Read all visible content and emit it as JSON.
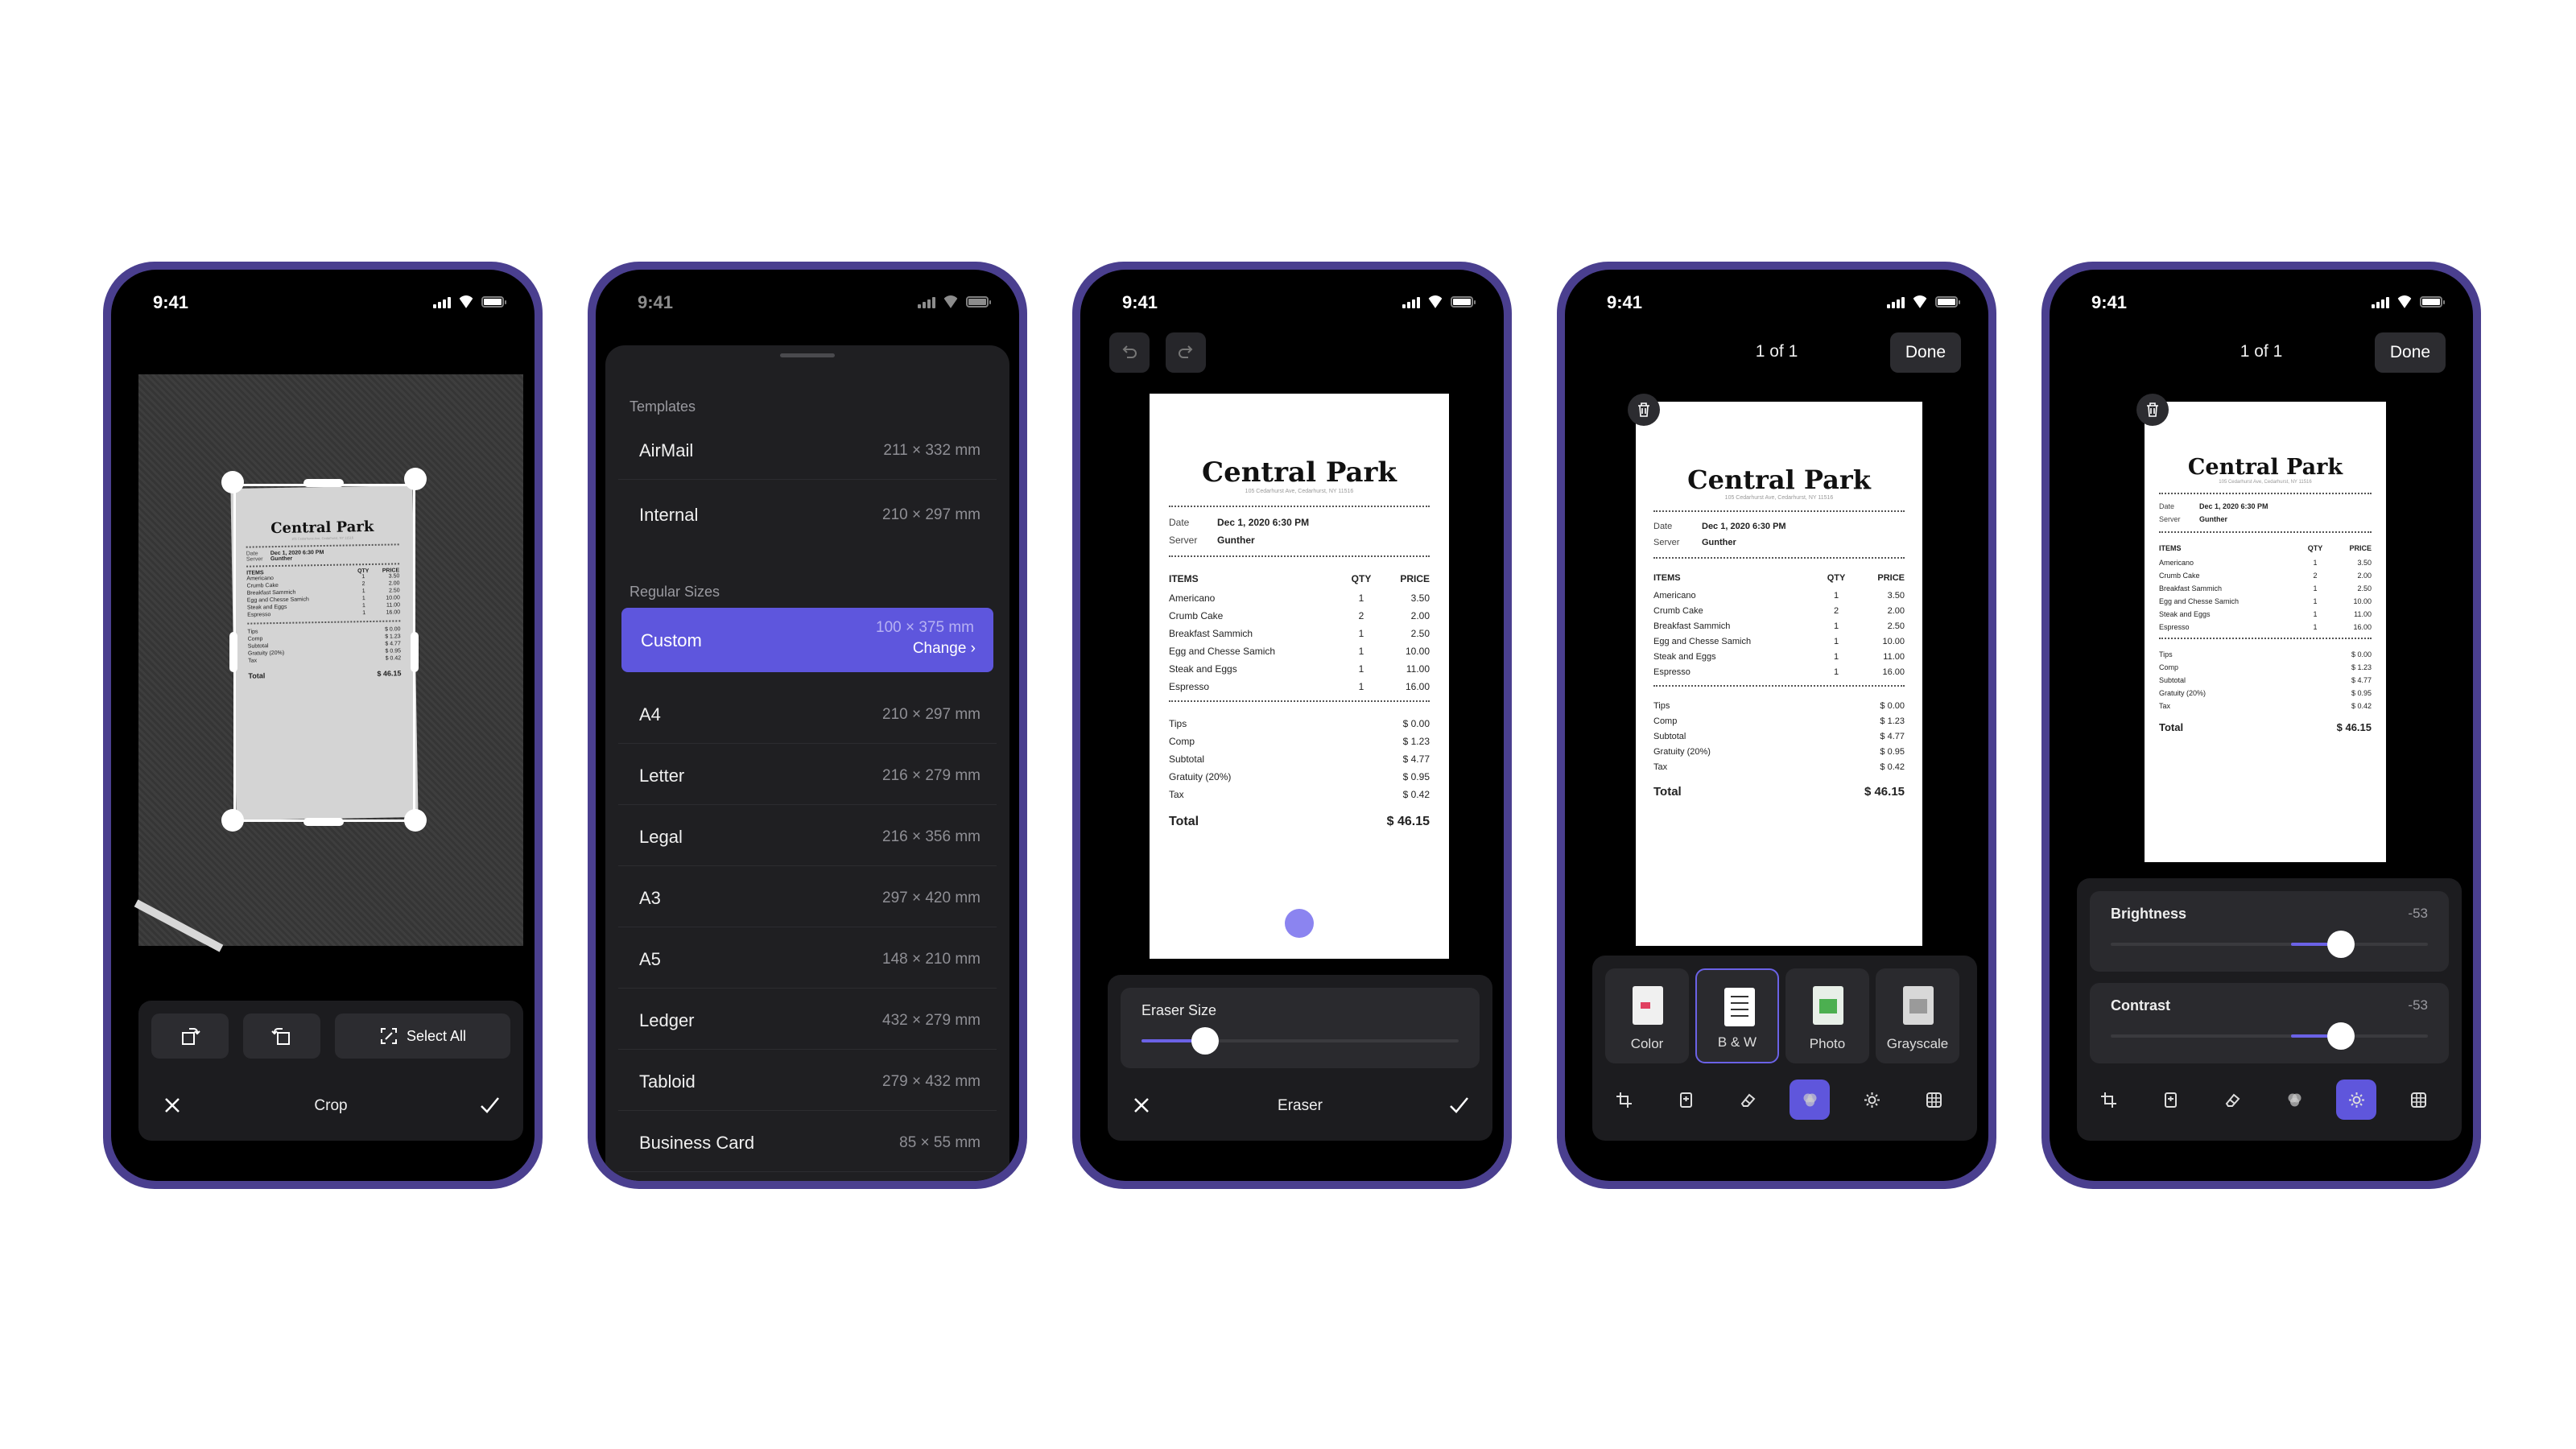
{
  "status_time": "9:41",
  "receipt": {
    "title": "Central Park",
    "address": "105 Cedarhurst Ave, Cedarhurst, NY 11516",
    "date_label": "Date",
    "date_value": "Dec 1, 2020 6:30 PM",
    "server_label": "Server",
    "server_value": "Gunther",
    "col_items": "ITEMS",
    "col_qty": "QTY",
    "col_price": "PRICE",
    "items": [
      {
        "name": "Americano",
        "qty": "1",
        "price": "3.50"
      },
      {
        "name": "Crumb Cake",
        "qty": "2",
        "price": "2.00"
      },
      {
        "name": "Breakfast Sammich",
        "qty": "1",
        "price": "2.50"
      },
      {
        "name": "Egg and Chesse Samich",
        "qty": "1",
        "price": "10.00"
      },
      {
        "name": "Steak and Eggs",
        "qty": "1",
        "price": "11.00"
      },
      {
        "name": "Espresso",
        "qty": "1",
        "price": "16.00"
      }
    ],
    "summary": [
      {
        "label": "Tips",
        "value": "$ 0.00"
      },
      {
        "label": "Comp",
        "value": "$ 1.23"
      },
      {
        "label": "Subtotal",
        "value": "$ 4.77"
      },
      {
        "label": "Gratuity (20%)",
        "value": "$ 0.95"
      },
      {
        "label": "Tax",
        "value": "$ 0.42"
      }
    ],
    "total_label": "Total",
    "total_value": "$ 46.15"
  },
  "crop_screen": {
    "select_all": "Select All",
    "title": "Crop"
  },
  "size_screen": {
    "templates_header": "Templates",
    "templates": [
      {
        "name": "AirMail",
        "dims": "211 × 332 mm"
      },
      {
        "name": "Internal",
        "dims": "210 × 297 mm"
      }
    ],
    "regular_header": "Regular Sizes",
    "custom": {
      "name": "Custom",
      "dims": "100 × 375 mm",
      "change": "Change"
    },
    "regular": [
      {
        "name": "A4",
        "dims": "210 × 297 mm"
      },
      {
        "name": "Letter",
        "dims": "216 × 279 mm"
      },
      {
        "name": "Legal",
        "dims": "216 × 356 mm"
      },
      {
        "name": "A3",
        "dims": "297 × 420 mm"
      },
      {
        "name": "A5",
        "dims": "148 × 210 mm"
      },
      {
        "name": "Ledger",
        "dims": "432 × 279 mm"
      },
      {
        "name": "Tabloid",
        "dims": "279 × 432 mm"
      },
      {
        "name": "Business Card",
        "dims": "85 × 55 mm"
      }
    ]
  },
  "eraser_screen": {
    "eraser_size_label": "Eraser Size",
    "eraser_size_level": 0.2,
    "title": "Eraser"
  },
  "filter_screen": {
    "page_indicator": "1 of 1",
    "done": "Done",
    "filters": [
      "Color",
      "B & W",
      "Photo",
      "Grayscale"
    ],
    "selected_filter": "B & W"
  },
  "adjust_screen": {
    "page_indicator": "1 of 1",
    "done": "Done",
    "brightness_label": "Brightness",
    "brightness_value": "-53",
    "contrast_label": "Contrast",
    "contrast_value": "-53"
  },
  "colors": {
    "frame": "#4a3f8f",
    "accent": "#6b62e6",
    "panel": "#1c1c1f"
  }
}
